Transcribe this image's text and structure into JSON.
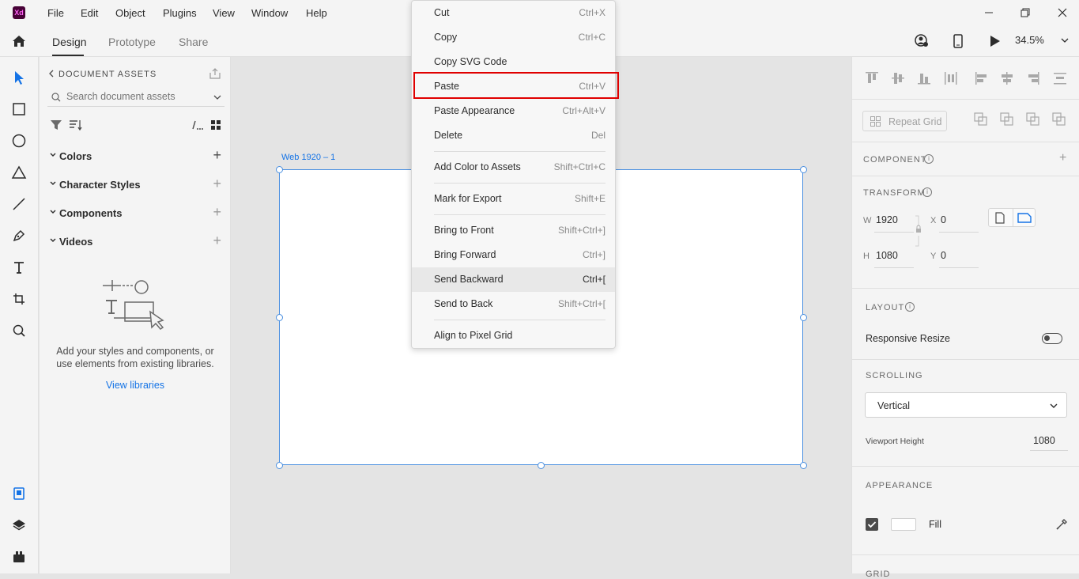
{
  "app": {
    "logo": "Xd"
  },
  "menubar": [
    "File",
    "Edit",
    "Object",
    "Plugins",
    "View",
    "Window",
    "Help"
  ],
  "modes": {
    "design": "Design",
    "prototype": "Prototype",
    "share": "Share"
  },
  "zoom": "34.5%",
  "assets": {
    "title": "DOCUMENT ASSETS",
    "search_placeholder": "Search document assets",
    "sections": [
      {
        "label": "Colors"
      },
      {
        "label": "Character Styles"
      },
      {
        "label": "Components"
      },
      {
        "label": "Videos"
      }
    ],
    "empty_text": "Add your styles and components, or use elements from existing libraries.",
    "view_libraries": "View libraries"
  },
  "artboard": {
    "label": "Web 1920 – 1"
  },
  "context_menu": [
    {
      "label": "Cut",
      "shortcut": "Ctrl+X"
    },
    {
      "label": "Copy",
      "shortcut": "Ctrl+C"
    },
    {
      "label": "Copy SVG Code",
      "shortcut": ""
    },
    {
      "label": "Paste",
      "shortcut": "Ctrl+V"
    },
    {
      "label": "Paste Appearance",
      "shortcut": "Ctrl+Alt+V"
    },
    {
      "label": "Delete",
      "shortcut": "Del"
    },
    {
      "label": "Add Color to Assets",
      "shortcut": "Shift+Ctrl+C"
    },
    {
      "label": "Mark for Export",
      "shortcut": "Shift+E"
    },
    {
      "label": "Bring to Front",
      "shortcut": "Shift+Ctrl+]"
    },
    {
      "label": "Bring Forward",
      "shortcut": "Ctrl+]"
    },
    {
      "label": "Send Backward",
      "shortcut": "Ctrl+["
    },
    {
      "label": "Send to Back",
      "shortcut": "Shift+Ctrl+["
    },
    {
      "label": "Align to Pixel Grid",
      "shortcut": ""
    }
  ],
  "props": {
    "repeat_grid": "Repeat Grid",
    "component_title": "COMPONENT",
    "transform_title": "TRANSFORM",
    "w_label": "W",
    "w_value": "1920",
    "h_label": "H",
    "h_value": "1080",
    "x_label": "X",
    "x_value": "0",
    "y_label": "Y",
    "y_value": "0",
    "layout_title": "LAYOUT",
    "responsive_resize": "Responsive Resize",
    "scrolling_title": "SCROLLING",
    "scrolling_value": "Vertical",
    "viewport_height_label": "Viewport Height",
    "viewport_height_value": "1080",
    "appearance_title": "APPEARANCE",
    "fill_label": "Fill",
    "grid_title": "GRID"
  },
  "colors": {
    "accent": "#1473e6",
    "highlight": "#e00000"
  }
}
